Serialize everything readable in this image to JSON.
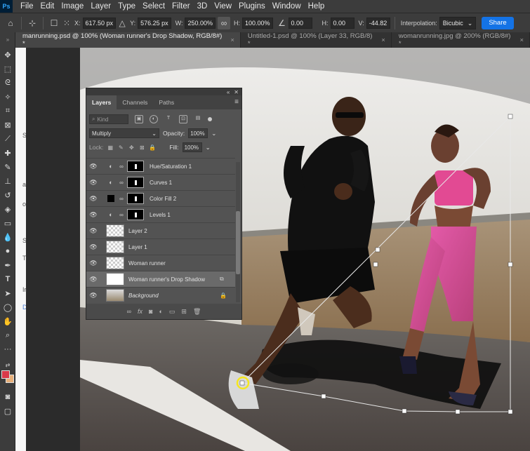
{
  "app": {
    "logo": "Ps"
  },
  "menu": [
    "File",
    "Edit",
    "Image",
    "Layer",
    "Type",
    "Select",
    "Filter",
    "3D",
    "View",
    "Plugins",
    "Window",
    "Help"
  ],
  "options": {
    "x_label": "X:",
    "x_value": "617.50 px",
    "y_label": "Y:",
    "y_value": "576.25 px",
    "w_label": "W:",
    "w_value": "250.00%",
    "h_label": "H:",
    "h_value": "100.00%",
    "angle_value": "0.00",
    "hskew_label": "H:",
    "hskew_value": "0.00",
    "vskew_label": "V:",
    "vskew_value": "-44.82",
    "interpolation_label": "Interpolation:",
    "interpolation_value": "Bicubic",
    "share_label": "Share"
  },
  "tabs": [
    {
      "label": "manrunning.psd @ 100% (Woman runner's Drop Shadow, RGB/8#) *",
      "close": "×"
    },
    {
      "label": "Untitled-1.psd @ 100% (Layer 33, RGB/8) *",
      "close": "×"
    },
    {
      "label": "womanrunning.jpg @ 200% (RGB/8#) *",
      "close": "×"
    }
  ],
  "page_strip": [
    "S",
    "ati",
    "ov",
    "S",
    "T",
    "Ir",
    "D"
  ],
  "layers_panel": {
    "tabs": [
      "Layers",
      "Channels",
      "Paths"
    ],
    "kind_label": "Kind",
    "blend_mode": "Multiply",
    "opacity_label": "Opacity:",
    "opacity_value": "100%",
    "lock_label": "Lock:",
    "fill_label": "Fill:",
    "fill_value": "100%",
    "layers": [
      {
        "name": "Hue/Saturation 1"
      },
      {
        "name": "Curves 1"
      },
      {
        "name": "Color Fill 2"
      },
      {
        "name": "Levels 1"
      },
      {
        "name": "Layer 2"
      },
      {
        "name": "Layer 1"
      },
      {
        "name": "Woman runner"
      },
      {
        "name": "Woman runner's Drop Shadow"
      },
      {
        "name": "Background"
      }
    ]
  },
  "colors": {
    "foreground": "#d93a4a",
    "background": "#e8b07a",
    "accent": "#1473e6"
  }
}
